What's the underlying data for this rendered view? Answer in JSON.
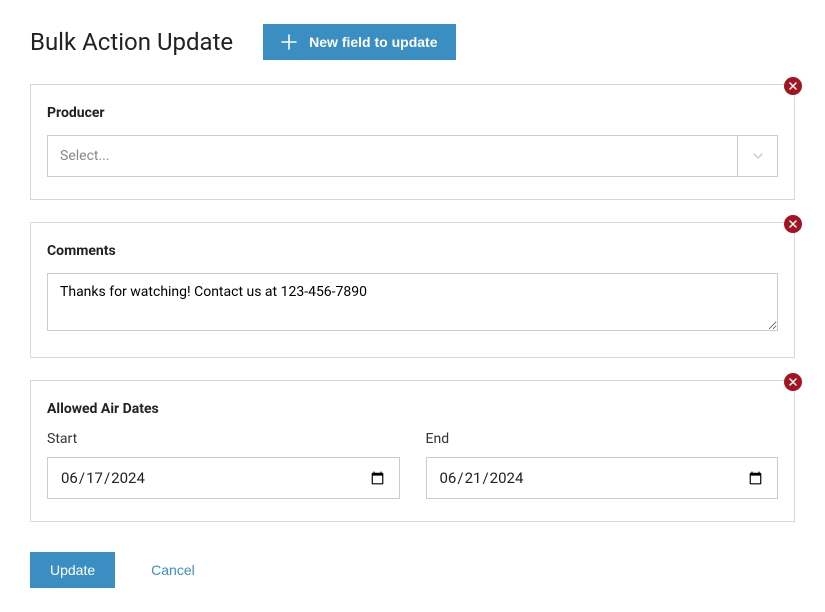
{
  "header": {
    "title": "Bulk Action Update",
    "new_field_button": "New field to update"
  },
  "fields": {
    "producer": {
      "label": "Producer",
      "placeholder": "Select..."
    },
    "comments": {
      "label": "Comments",
      "value": "Thanks for watching! Contact us at 123-456-7890"
    },
    "air_dates": {
      "label": "Allowed Air Dates",
      "start_label": "Start",
      "start_value": "2024-06-17",
      "end_label": "End",
      "end_value": "2024-06-21"
    }
  },
  "actions": {
    "update": "Update",
    "cancel": "Cancel"
  }
}
